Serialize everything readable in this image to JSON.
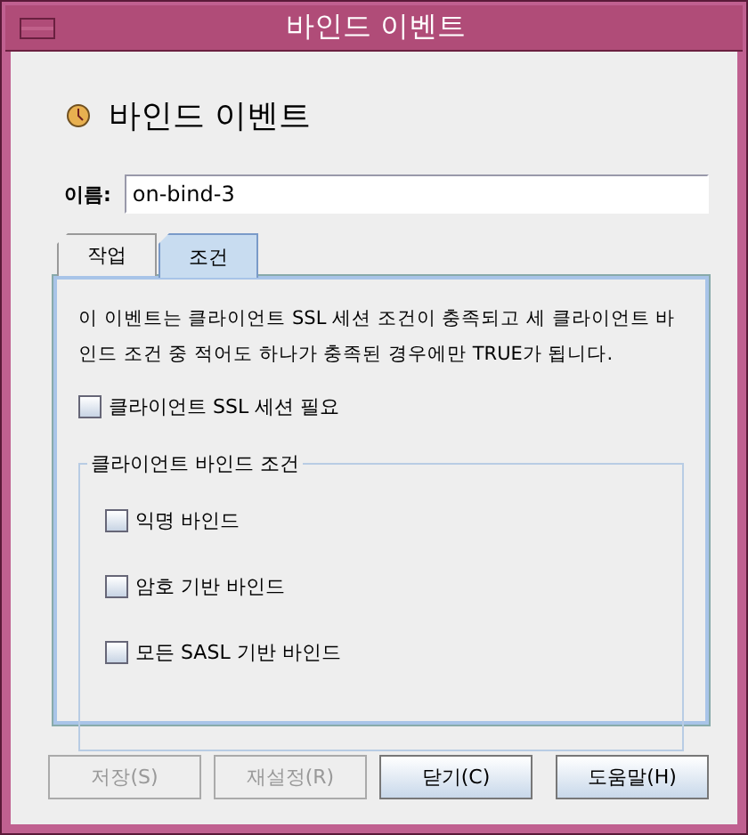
{
  "window": {
    "title": "바인드 이벤트"
  },
  "heading": "바인드 이벤트",
  "name_field": {
    "label": "이름:",
    "value": "on-bind-3"
  },
  "tabs": [
    {
      "label": "작업",
      "selected": false
    },
    {
      "label": "조건",
      "selected": true
    }
  ],
  "description": "이 이벤트는 클라이언트 SSL 세션 조건이 충족되고 세 클라이언트 바인드 조건 중 적어도 하나가 충족된 경우에만 TRUE가 됩니다.",
  "ssl_required": {
    "label": "클라이언트 SSL 세션 필요",
    "checked": false
  },
  "bind_group": {
    "title": "클라이언트 바인드 조건",
    "options": [
      {
        "label": "익명 바인드",
        "checked": false
      },
      {
        "label": "암호 기반 바인드",
        "checked": false
      },
      {
        "label": "모든 SASL 기반 바인드",
        "checked": false
      }
    ]
  },
  "buttons": [
    {
      "label": "저장(S)",
      "disabled": true
    },
    {
      "label": "재설정(R)",
      "disabled": true
    },
    {
      "label": "닫기(C)",
      "disabled": false
    },
    {
      "label": "도움말(H)",
      "disabled": false
    }
  ]
}
